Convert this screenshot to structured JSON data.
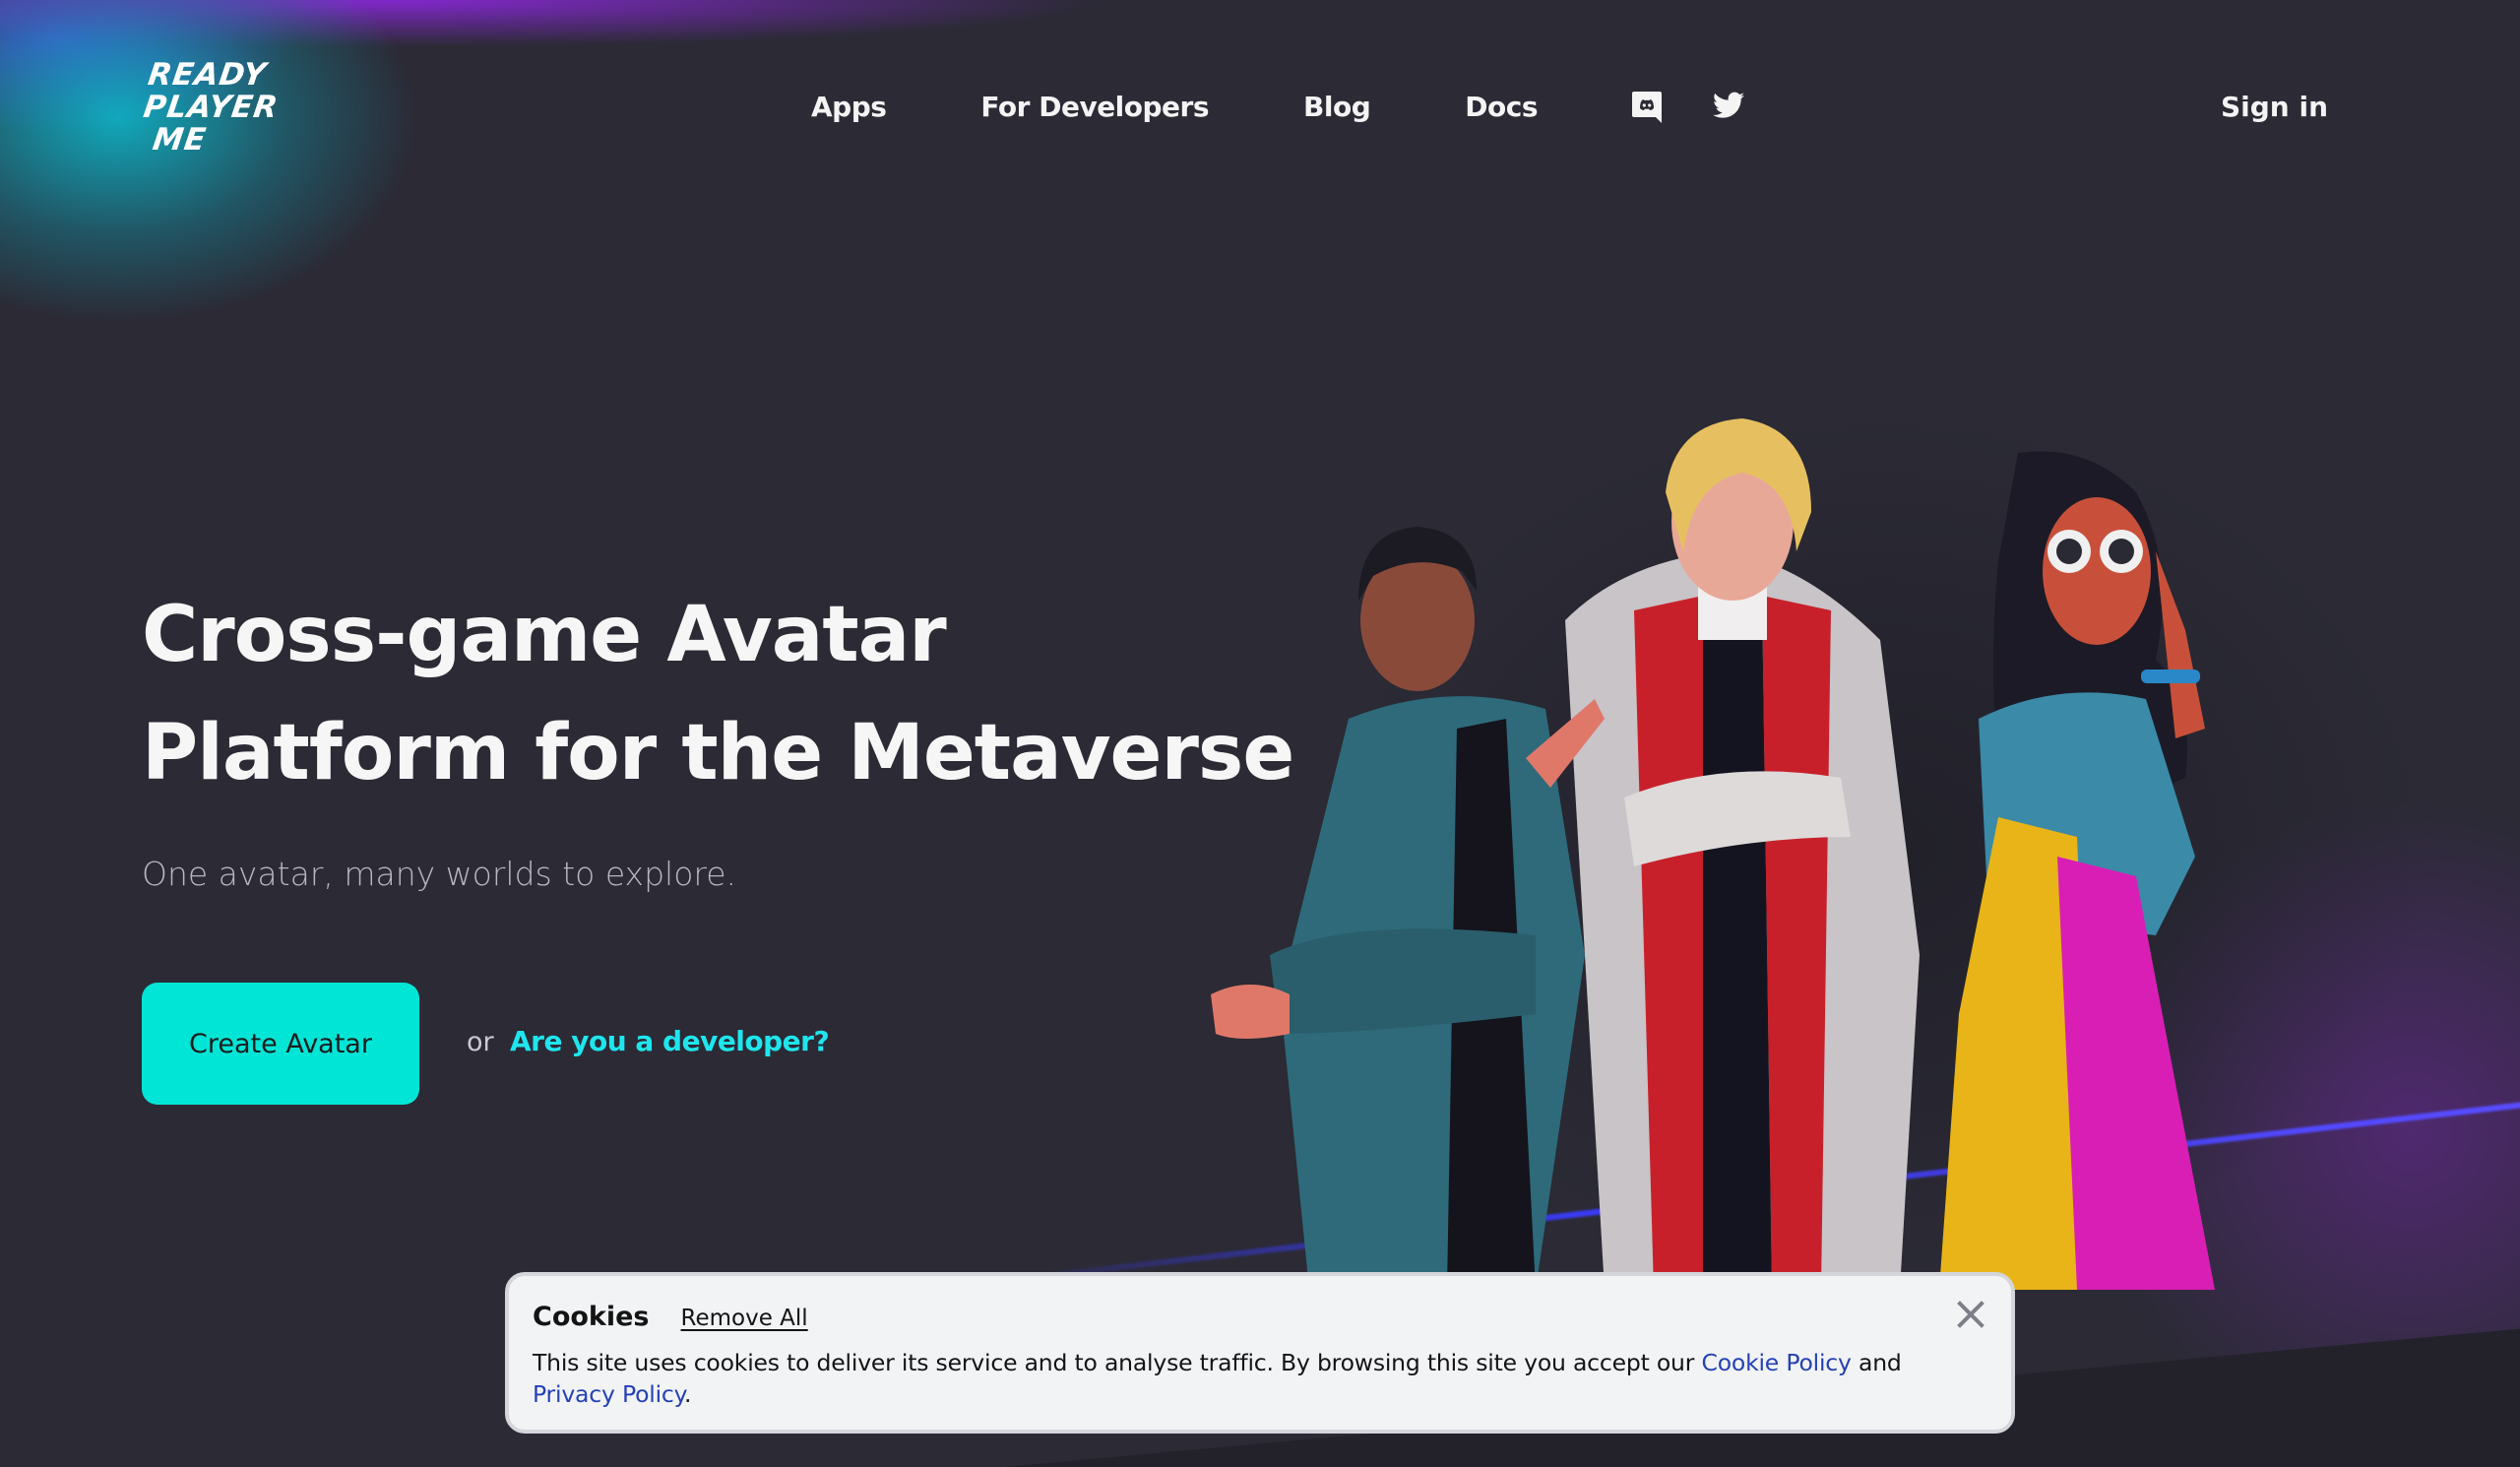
{
  "brand": {
    "logo_lines": [
      "READY",
      "PLAYER",
      "ME"
    ],
    "accent_color": "#00e5d6",
    "link_color": "#1ee6ee",
    "background_color": "#2b2a35"
  },
  "nav": {
    "items": [
      {
        "label": "Apps"
      },
      {
        "label": "For Developers"
      },
      {
        "label": "Blog"
      },
      {
        "label": "Docs"
      }
    ],
    "social_icons": [
      "discord-icon",
      "twitter-icon"
    ],
    "sign_in_label": "Sign in"
  },
  "hero": {
    "title_line1": "Cross-game Avatar",
    "title_line2": "Platform for the Metaverse",
    "subtitle": "One avatar, many worlds to explore.",
    "cta_label": "Create Avatar",
    "or_label": "or",
    "developer_link_label": "Are you a developer?",
    "illustration": "three-3d-avatars"
  },
  "cookie_banner": {
    "title": "Cookies",
    "remove_all_label": "Remove All",
    "body_text": "This site uses cookies to deliver its service and to analyse traffic. By browsing this site you accept our ",
    "cookie_policy_label": "Cookie Policy",
    "and_text": " and ",
    "privacy_policy_label": "Privacy Policy",
    "end_text": ".",
    "close_icon": "close-icon"
  }
}
